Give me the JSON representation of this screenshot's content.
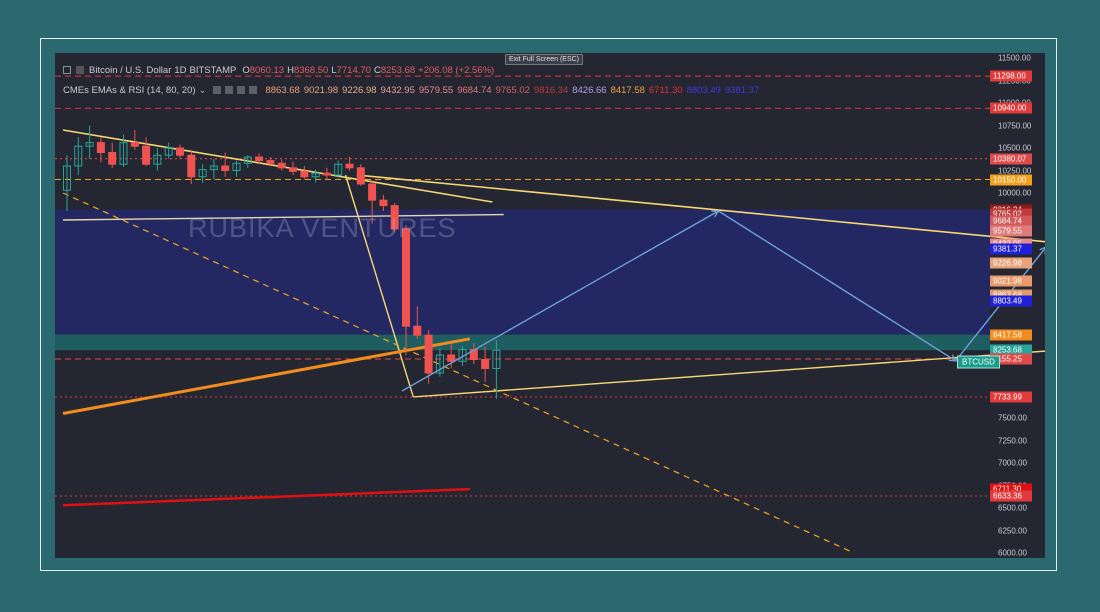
{
  "header": {
    "title": "Bitcoin / U.S. Dollar",
    "interval": "1D",
    "exchange": "BITSTAMP",
    "ohlc": [
      {
        "k": "O",
        "v": "8060.13"
      },
      {
        "k": "H",
        "v": "8368.50"
      },
      {
        "k": "L",
        "v": "7714.70"
      },
      {
        "k": "C",
        "v": "8253.68"
      }
    ],
    "change": "+206.08 (+2.56%)",
    "indicator": "CMEs EMAs & RSI (14, 80, 20)",
    "ema_values": [
      {
        "v": "8863.68",
        "color": "#e8a27a"
      },
      {
        "v": "9021.98",
        "color": "#e8a27a"
      },
      {
        "v": "9226.98",
        "color": "#e8b08a"
      },
      {
        "v": "9432.95",
        "color": "#e89a9a"
      },
      {
        "v": "9579.55",
        "color": "#e88a8a"
      },
      {
        "v": "9684.74",
        "color": "#e07a7a"
      },
      {
        "v": "9765.02",
        "color": "#d06060"
      },
      {
        "v": "9816.34",
        "color": "#c03a3a"
      },
      {
        "v": "8426.66",
        "color": "#b89ae8"
      },
      {
        "v": "8417.58",
        "color": "#f2a040"
      },
      {
        "v": "6711.30",
        "color": "#e03030"
      },
      {
        "v": "8803.49",
        "color": "#3a3ae0"
      },
      {
        "v": "9381.37",
        "color": "#3a3ae0"
      }
    ]
  },
  "exit_fullscreen": "Exit Full Screen (ESC)",
  "watermark": "RUBIKA VENTURES",
  "symbol_tag": "BTCUSD",
  "colors": {
    "bull": "#26a69a",
    "bear": "#ef5350",
    "zone": "#232862",
    "zone_teal": "#1f5e60",
    "trend_yellow": "#f7d774",
    "orange": "#f5a623",
    "projection": "#6f9fd8"
  },
  "chart_data": {
    "type": "candlestick",
    "title": "Bitcoin / U.S. Dollar",
    "interval": "1D",
    "ylim": [
      6000,
      11500
    ],
    "y_ticks": [
      6000,
      6250,
      6500,
      6750,
      7000,
      7250,
      7500,
      7750,
      10000,
      10250,
      10500,
      10750,
      11000,
      11250,
      11500
    ],
    "price_labels": [
      {
        "value": 11298.0,
        "text": "11298.00",
        "color": "#e03a3a"
      },
      {
        "value": 10940.0,
        "text": "10940.00",
        "color": "#e03a3a"
      },
      {
        "value": 10380.07,
        "text": "10380.07",
        "color": "#e04a4a"
      },
      {
        "value": 10150.0,
        "text": "10150.00",
        "color": "#f2a11e"
      },
      {
        "value": 9816.34,
        "text": "9816.34",
        "color": "#8e1a1a"
      },
      {
        "value": 9765.02,
        "text": "9765.02",
        "color": "#c03a3a"
      },
      {
        "value": 9684.74,
        "text": "9684.74",
        "color": "#d05a5a"
      },
      {
        "value": 9579.55,
        "text": "9579.55",
        "color": "#e07a7a"
      },
      {
        "value": 9432.95,
        "text": "9432.95",
        "color": "#e88a8a"
      },
      {
        "value": 9381.37,
        "text": "9381.37",
        "color": "#2020d8"
      },
      {
        "value": 9226.98,
        "text": "9226.98",
        "color": "#e8a27a"
      },
      {
        "value": 9021.98,
        "text": "9021.98",
        "color": "#e89a6a"
      },
      {
        "value": 8863.68,
        "text": "8863.68",
        "color": "#e09a6a"
      },
      {
        "value": 8803.49,
        "text": "8803.49",
        "color": "#2020d8"
      },
      {
        "value": 8426.66,
        "text": "8426.66",
        "color": "#b89ae8"
      },
      {
        "value": 8417.58,
        "text": "8417.58",
        "color": "#f28c1e"
      },
      {
        "value": 8253.68,
        "text": "8253.68",
        "color": "#26a69a"
      },
      {
        "value": 8155.25,
        "text": "8155.25",
        "color": "#e04a4a"
      },
      {
        "value": 7733.99,
        "text": "7733.99",
        "color": "#e03a3a"
      },
      {
        "value": 6711.3,
        "text": "6711.30",
        "color": "#e01010"
      },
      {
        "value": 6633.36,
        "text": "6633.36",
        "color": "#e03a3a"
      }
    ],
    "horizontal_lines": [
      {
        "value": 11298.0,
        "color": "#e03a3a",
        "style": "dashed"
      },
      {
        "value": 10940.0,
        "color": "#e03a3a",
        "style": "dashed"
      },
      {
        "value": 10380.07,
        "color": "#e04a4a",
        "style": "dotted"
      },
      {
        "value": 10150.0,
        "color": "#f2a11e",
        "style": "dashed"
      },
      {
        "value": 8155.25,
        "color": "#e04a4a",
        "style": "dashed"
      },
      {
        "value": 7733.99,
        "color": "#e03a3a",
        "style": "dotted"
      },
      {
        "value": 6633.36,
        "color": "#e03a3a",
        "style": "dotted"
      }
    ],
    "zones": [
      {
        "from": 8426.66,
        "to": 9816.34,
        "color": "#232862"
      },
      {
        "from": 8253.68,
        "to": 8426.66,
        "color": "#1f5e60"
      }
    ],
    "candles": [
      {
        "o": 10030,
        "h": 10420,
        "l": 9800,
        "c": 10300
      },
      {
        "o": 10300,
        "h": 10620,
        "l": 10200,
        "c": 10520
      },
      {
        "o": 10520,
        "h": 10750,
        "l": 10380,
        "c": 10560
      },
      {
        "o": 10560,
        "h": 10620,
        "l": 10340,
        "c": 10450
      },
      {
        "o": 10450,
        "h": 10560,
        "l": 10280,
        "c": 10320
      },
      {
        "o": 10320,
        "h": 10650,
        "l": 10290,
        "c": 10560
      },
      {
        "o": 10560,
        "h": 10700,
        "l": 10480,
        "c": 10520
      },
      {
        "o": 10520,
        "h": 10620,
        "l": 10300,
        "c": 10320
      },
      {
        "o": 10320,
        "h": 10500,
        "l": 10250,
        "c": 10420
      },
      {
        "o": 10420,
        "h": 10560,
        "l": 10380,
        "c": 10500
      },
      {
        "o": 10500,
        "h": 10540,
        "l": 10380,
        "c": 10420
      },
      {
        "o": 10420,
        "h": 10480,
        "l": 10100,
        "c": 10180
      },
      {
        "o": 10180,
        "h": 10320,
        "l": 10110,
        "c": 10260
      },
      {
        "o": 10260,
        "h": 10380,
        "l": 10150,
        "c": 10300
      },
      {
        "o": 10300,
        "h": 10450,
        "l": 10180,
        "c": 10250
      },
      {
        "o": 10250,
        "h": 10360,
        "l": 10180,
        "c": 10330
      },
      {
        "o": 10330,
        "h": 10420,
        "l": 10280,
        "c": 10400
      },
      {
        "o": 10400,
        "h": 10440,
        "l": 10320,
        "c": 10360
      },
      {
        "o": 10360,
        "h": 10400,
        "l": 10300,
        "c": 10330
      },
      {
        "o": 10330,
        "h": 10370,
        "l": 10250,
        "c": 10280
      },
      {
        "o": 10280,
        "h": 10350,
        "l": 10200,
        "c": 10240
      },
      {
        "o": 10240,
        "h": 10300,
        "l": 10150,
        "c": 10180
      },
      {
        "o": 10180,
        "h": 10260,
        "l": 10120,
        "c": 10220
      },
      {
        "o": 10220,
        "h": 10280,
        "l": 10150,
        "c": 10200
      },
      {
        "o": 10200,
        "h": 10360,
        "l": 10170,
        "c": 10320
      },
      {
        "o": 10320,
        "h": 10400,
        "l": 10250,
        "c": 10280
      },
      {
        "o": 10280,
        "h": 10320,
        "l": 10080,
        "c": 10100
      },
      {
        "o": 10100,
        "h": 10140,
        "l": 9660,
        "c": 9920
      },
      {
        "o": 9920,
        "h": 9980,
        "l": 9800,
        "c": 9860
      },
      {
        "o": 9860,
        "h": 9890,
        "l": 9560,
        "c": 9600
      },
      {
        "o": 9600,
        "h": 9640,
        "l": 8200,
        "c": 8520
      },
      {
        "o": 8520,
        "h": 8740,
        "l": 8380,
        "c": 8420
      },
      {
        "o": 8420,
        "h": 8480,
        "l": 7880,
        "c": 8000
      },
      {
        "o": 8000,
        "h": 8280,
        "l": 7960,
        "c": 8200
      },
      {
        "o": 8200,
        "h": 8320,
        "l": 8050,
        "c": 8130
      },
      {
        "o": 8130,
        "h": 8300,
        "l": 8080,
        "c": 8260
      },
      {
        "o": 8260,
        "h": 8330,
        "l": 8100,
        "c": 8150
      },
      {
        "o": 8150,
        "h": 8290,
        "l": 7900,
        "c": 8050
      },
      {
        "o": 8050,
        "h": 8368.5,
        "l": 7714.7,
        "c": 8253.68
      }
    ],
    "trendlines": [
      {
        "x1": 0,
        "y1": 10700,
        "x2": 38,
        "y2": 9900,
        "color": "#f7d774",
        "width": 1.6,
        "dash": false
      },
      {
        "x1": 26,
        "y1": 10200,
        "x2": 93,
        "y2": 9385,
        "color": "#f7d774",
        "width": 1.6,
        "dash": false
      },
      {
        "x1": 0,
        "y1": 9700,
        "x2": 39,
        "y2": 9760,
        "color": "#e8d7a8",
        "width": 1.4,
        "dash": false
      },
      {
        "x1": 31,
        "y1": 7734,
        "x2": 88,
        "y2": 8253,
        "color": "#f7d774",
        "width": 1.4,
        "dash": false
      },
      {
        "x1": 25,
        "y1": 10200,
        "x2": 31,
        "y2": 7734,
        "color": "#f7d774",
        "width": 1.4,
        "dash": false
      },
      {
        "x1": 0,
        "y1": 10000,
        "x2": 70,
        "y2": 6000,
        "color": "#f5a623",
        "width": 1.2,
        "dash": true
      },
      {
        "x1": 0,
        "y1": 7550,
        "x2": 36,
        "y2": 8380,
        "color": "#f28c1e",
        "width": 3,
        "dash": false
      },
      {
        "x1": 0,
        "y1": 6530,
        "x2": 36,
        "y2": 6710,
        "color": "#e01010",
        "width": 2.5,
        "dash": false
      }
    ],
    "projection_path": [
      {
        "x": 30,
        "y": 7800
      },
      {
        "x": 58,
        "y": 9800
      },
      {
        "x": 79,
        "y": 8135
      },
      {
        "x": 87,
        "y": 9400
      },
      {
        "x": 94,
        "y": 8810
      }
    ]
  }
}
